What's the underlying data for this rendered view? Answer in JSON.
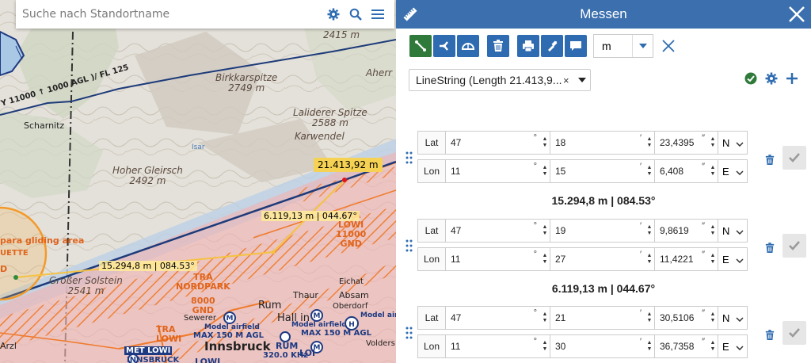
{
  "search": {
    "placeholder": "Suche nach Standortname"
  },
  "map": {
    "peaks": [
      {
        "name": "Birkkarspitze",
        "elev": "2749 m"
      },
      {
        "name": "Laliderer Spitze",
        "elev": "2588 m"
      },
      {
        "name": "Hoher Gleirsch",
        "elev": "2492 m"
      },
      {
        "name": "Großer Solstein",
        "elev": "2541 m"
      }
    ],
    "elevation_top": "2415 m",
    "places": [
      "Aherr",
      "Karwendel",
      "Scharnitz",
      "Isar",
      "Rum",
      "Thaur",
      "Absam",
      "Hall in",
      "Innsbruck",
      "Eichat",
      "Oberdorf",
      "Sewerer",
      "Volders",
      "Arzl"
    ],
    "airspace_left": {
      "name": "para gliding area",
      "sub": "UETTE",
      "letter": "D"
    },
    "airspace_tra": {
      "line1": "TRA",
      "line2": "LOWI",
      "line3": "11000",
      "line4": "GND"
    },
    "airspace_nordpark": {
      "line1": "TRA",
      "line2": "NORDPARK",
      "line3": "8000",
      "line4": "GND"
    },
    "airspace_lowi_bottom": {
      "line1": "TRA",
      "line2": "LOWI"
    },
    "airway_label": "Y 11000 ↑ 1000 AGL )/ FL 125",
    "airfield_labels": [
      "Model airfield",
      "MAX 150 M AGL",
      "Model airfield",
      "MAX 150 M AGL",
      "Model airfield"
    ],
    "bottom_labels": {
      "met": "MET LOWI",
      "inns": "INNSBRUCK",
      "rum": "RUM",
      "freq": "320.0 KHz",
      "lowi": "LOWI",
      "loi": "LOI"
    },
    "segment_labels": [
      "15.294,8 m | 084.53°",
      "6.119,13 m | 044.67°"
    ],
    "total_label": "21.413,92 m"
  },
  "panel": {
    "title": "Messen",
    "unit": "m",
    "feature_select": "LineString (Length 21.413,9...",
    "points": [
      {
        "lat": {
          "deg": "47",
          "min": "18",
          "sec": "23,4395",
          "hemi": "N"
        },
        "lon": {
          "deg": "11",
          "min": "15",
          "sec": "6,408",
          "hemi": "E"
        }
      },
      {
        "lat": {
          "deg": "47",
          "min": "19",
          "sec": "9,8619",
          "hemi": "N"
        },
        "lon": {
          "deg": "11",
          "min": "27",
          "sec": "11,4221",
          "hemi": "E"
        }
      },
      {
        "lat": {
          "deg": "47",
          "min": "21",
          "sec": "30,5106",
          "hemi": "N"
        },
        "lon": {
          "deg": "11",
          "min": "30",
          "sec": "36,7358",
          "hemi": "E"
        }
      }
    ],
    "segments": [
      "15.294,8 m | 084.53°",
      "6.119,13 m | 044.67°"
    ],
    "lat_label": "Lat",
    "lon_label": "Lon",
    "deg_unit": "°",
    "min_unit": "′",
    "sec_unit": "″"
  },
  "colors": {
    "header": "#3b6fae",
    "active_tool": "#2f7a3a",
    "tool": "#2e6bb0",
    "measure_line": "#1d3b7a",
    "route": "#f5c242"
  }
}
